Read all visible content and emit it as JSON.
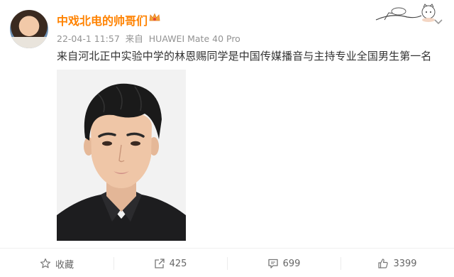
{
  "user": {
    "name": "中戏北电的帅哥们"
  },
  "meta": {
    "date": "22-04-1 11:57",
    "source_prefix": "来自",
    "device": "HUAWEI Mate 40 Pro"
  },
  "post": {
    "text": "来自河北正中实验中学的林恩赐同学是中国传媒播音与主持专业全国男生第一名"
  },
  "actions": {
    "favorite_label": "收藏",
    "repost_count": "425",
    "comment_count": "699",
    "like_count": "3399"
  },
  "colors": {
    "username": "#ff8200",
    "muted": "#939393",
    "text": "#333333"
  }
}
